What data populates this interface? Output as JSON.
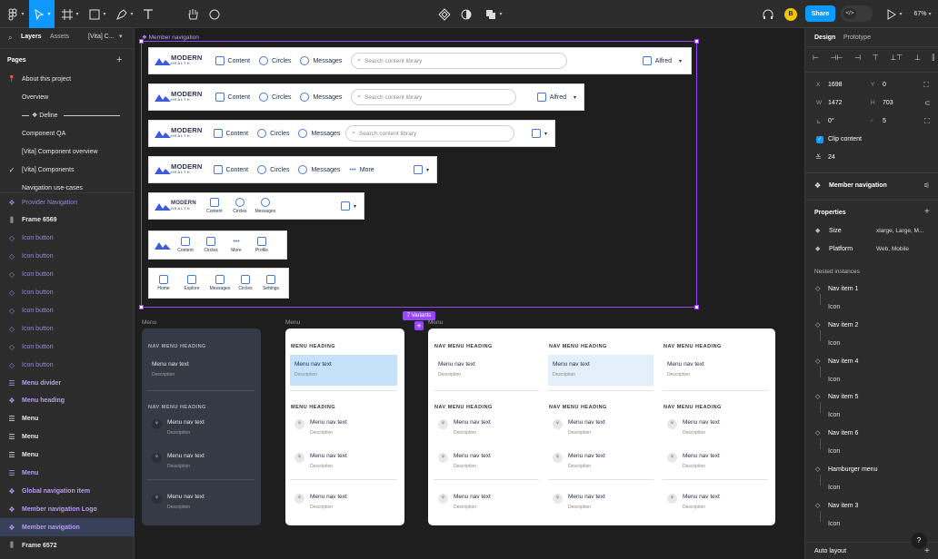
{
  "topbar": {
    "share": "Share",
    "zoom": "67%",
    "avatar": "B"
  },
  "left": {
    "tab_layers": "Layers",
    "tab_assets": "Assets",
    "file": "[Vita] C...",
    "pages_title": "Pages",
    "pages": [
      "About this project",
      "Overview",
      "Define",
      "Component QA",
      "[Vita] Component overview",
      "[Vita] Components",
      "Navigation use-cases"
    ],
    "layers": [
      "Provider Navigation",
      "Frame 6569",
      "Icon button",
      "Icon button",
      "Icon button",
      "Icon button",
      "Icon button",
      "Icon button",
      "Icon button",
      "Icon button",
      "Menu divider",
      "Menu heading",
      "Menu",
      "Menu",
      "Menu",
      "Menu",
      "Global navigation item",
      "Member navigation Logo",
      "Member navigation",
      "Frame 6572"
    ]
  },
  "canvas": {
    "frame_label": "Member navigation",
    "variants_badge": "7 Variants",
    "menu_label": "Menu",
    "logo_line1": "MODERN",
    "logo_line2": "HEALTH",
    "nav_items": {
      "content": "Content",
      "circles": "Circles",
      "messages": "Messages",
      "more": "More",
      "profile": "Profile",
      "home": "Home",
      "explore": "Explore",
      "settings": "Settings"
    },
    "search_placeholder": "Search content library",
    "user": "Alfred",
    "menu": {
      "heading_dark": "NAV MENU HEADING",
      "heading_light": "MENU HEADING",
      "item": "Menu nav text",
      "desc": "Description"
    }
  },
  "right": {
    "tab_design": "Design",
    "tab_prototype": "Prototype",
    "x": "1698",
    "y": "0",
    "w": "1472",
    "h": "703",
    "rotation": "0°",
    "radius": "5",
    "clip": "Clip content",
    "gap": "24",
    "component": "Member navigation",
    "properties": "Properties",
    "size_label": "Size",
    "size_val": "xlarge, Large, M...",
    "platform_label": "Platform",
    "platform_val": "Web, Mobile",
    "nested": "Nested instances",
    "instances": [
      {
        "name": "Nav item 1",
        "sub": "Icon"
      },
      {
        "name": "Nav item 2",
        "sub": "Icon"
      },
      {
        "name": "Nav item 4",
        "sub": "Icon"
      },
      {
        "name": "Nav item 5",
        "sub": "Icon"
      },
      {
        "name": "Nav item 6",
        "sub": "Icon"
      },
      {
        "name": "Hamburger menu",
        "sub": "Icon"
      },
      {
        "name": "Nav item 3",
        "sub": "Icon"
      }
    ],
    "auto_layout": "Auto layout"
  },
  "colors": {
    "accent": "#0d99ff",
    "frame_purple": "#9747ff",
    "menu_selected": "#c6e2fb"
  }
}
